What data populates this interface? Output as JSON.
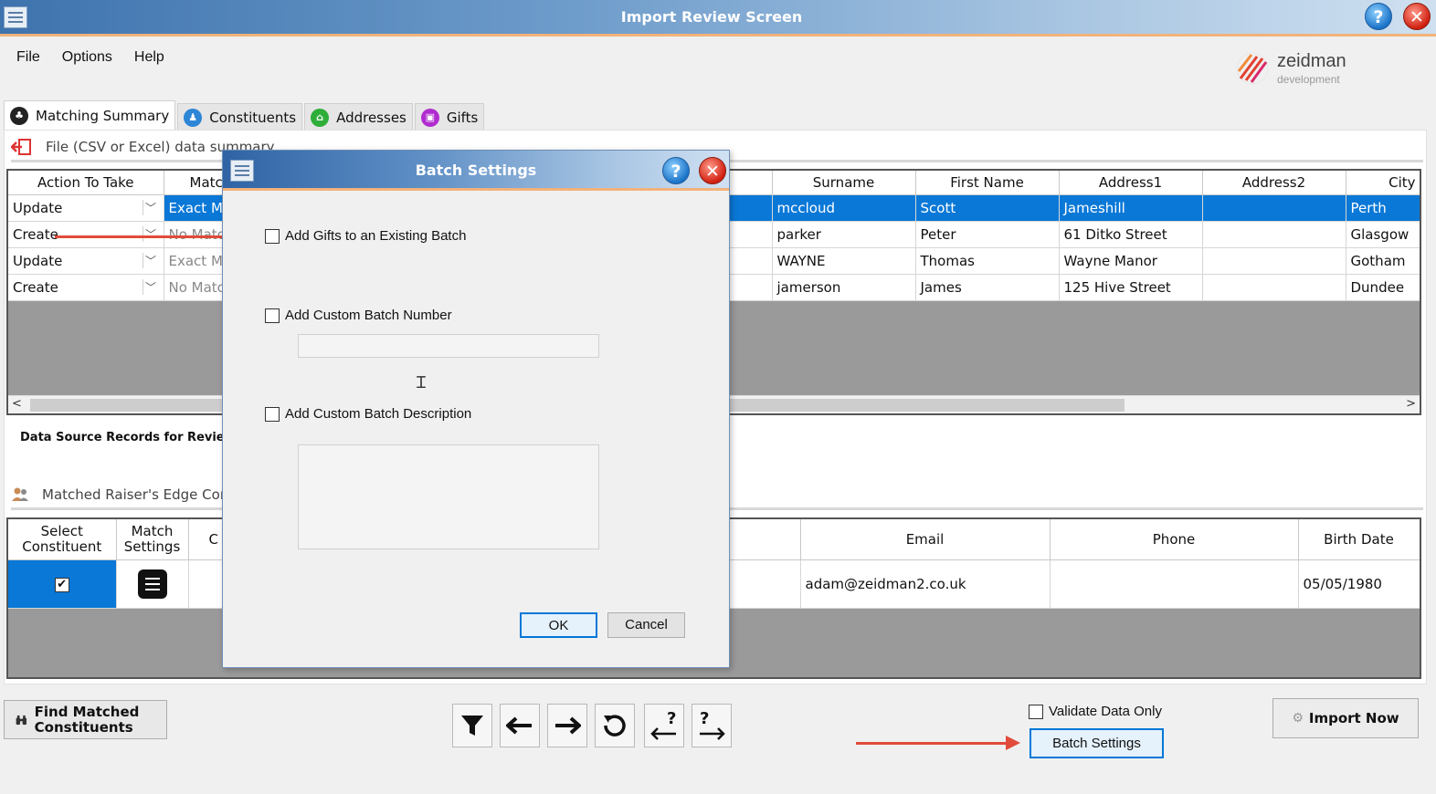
{
  "window": {
    "title": "Import Review Screen",
    "help": "?",
    "close": "✕"
  },
  "menu": [
    "File",
    "Options",
    "Help"
  ],
  "logo": {
    "name": "zeidman",
    "sub": "development"
  },
  "tabs": [
    "Matching Summary",
    "Constituents",
    "Addresses",
    "Gifts"
  ],
  "file_summary": {
    "label": "File (CSV or Excel) data summary"
  },
  "import_grid": {
    "columns_left": [
      "Action To Take",
      "Matc"
    ],
    "columns_right": [
      "Surname",
      "First Name",
      "Address1",
      "Address2",
      "City"
    ],
    "rows": [
      {
        "action": "Update",
        "match": "Exact M",
        "surname": "mccloud",
        "first": "Scott",
        "address1": "Jameshill",
        "address2": "",
        "city": "Perth"
      },
      {
        "action": "Create",
        "match": "No Matc",
        "surname": "parker",
        "first": "Peter",
        "address1": "61 Ditko Street",
        "address2": "",
        "city": "Glasgow"
      },
      {
        "action": "Update",
        "match": "Exact M",
        "surname": "WAYNE",
        "first": "Thomas",
        "address1": "Wayne Manor",
        "address2": "",
        "city": "Gotham"
      },
      {
        "action": "Create",
        "match": "No Matc",
        "surname": "jamerson",
        "first": "James",
        "address1": "125 Hive Street",
        "address2": "",
        "city": "Dundee"
      }
    ]
  },
  "data_source_label": "Data Source Records for Review :",
  "matched": {
    "label": "Matched Raiser's Edge Cor",
    "columns_left": [
      "Select Constituent",
      "Match Settings",
      "C"
    ],
    "columns_right": [
      "Email",
      "Phone",
      "Birth Date"
    ],
    "row": {
      "email": "adam@zeidman2.co.uk",
      "phone": "",
      "birth": "05/05/1980"
    }
  },
  "toolbar": {
    "find_matched": "Find Matched Constituents",
    "validate_only": "Validate Data Only",
    "batch_settings": "Batch Settings",
    "import_now": "Import Now"
  },
  "dialog": {
    "title": "Batch Settings",
    "opt_existing": "Add Gifts to an Existing Batch",
    "opt_number": "Add Custom Batch Number",
    "opt_description": "Add Custom Batch Description",
    "ok": "OK",
    "cancel": "Cancel"
  },
  "colors": {
    "selection": "#0a78d7",
    "arrow": "#e04b3a",
    "accent_line": "#f2b27a"
  }
}
